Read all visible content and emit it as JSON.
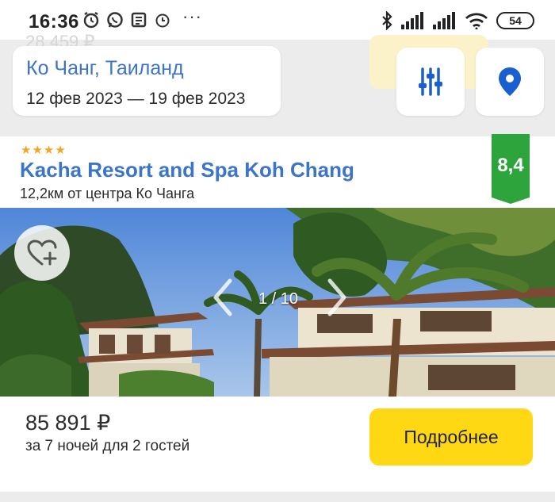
{
  "status_bar": {
    "time": "16:36",
    "battery": "54"
  },
  "ghost": {
    "price": "28 459 ₽"
  },
  "search": {
    "destination": "Ко Чанг, Таиланд",
    "dates": "12 фев 2023 — 19 фев 2023"
  },
  "icons": {
    "filter": "sliders-icon",
    "map": "map-pin-icon",
    "favorite": "heart-plus-icon",
    "prev": "chevron-left-icon",
    "next": "chevron-right-icon"
  },
  "hotel": {
    "stars": "★★★★",
    "star_count": 4,
    "name": "Kacha Resort and Spa Koh Chang",
    "distance_value": "12,2км",
    "distance_text": " от центра Ко Чанга",
    "rating": "8,4",
    "photo_counter": "1 / 10",
    "price": "85 891 ₽",
    "price_note": "за 7 ночей для 2 гостей",
    "details_label": "Подробнее"
  },
  "colors": {
    "link": "#3b74c9",
    "rating": "#2ea53c",
    "cta": "#ffd814",
    "stars": "#f5a623"
  }
}
